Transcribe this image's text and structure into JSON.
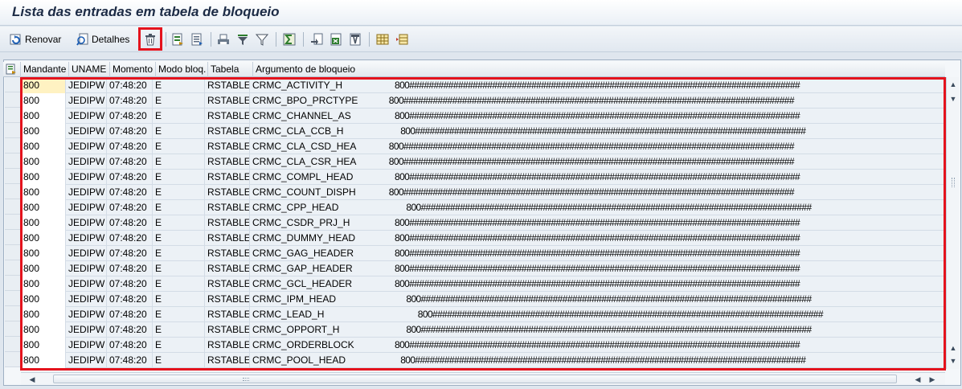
{
  "window": {
    "title": "Lista das entradas em tabela de bloqueio"
  },
  "toolbar": {
    "refresh_label": "Renovar",
    "details_label": "Detalhes",
    "icons": [
      "refresh-icon",
      "details-icon",
      "delete-icon",
      "select-layout-icon",
      "choose-layout-icon",
      "print-icon",
      "filter-set-icon",
      "filter-icon",
      "sum-icon",
      "export-icon",
      "excel-icon",
      "word-icon",
      "grid-icon",
      "layout-icon"
    ]
  },
  "colors": {
    "highlight": "#e4131d",
    "row_bg": "#ecf1f6",
    "selected_cell": "#fff2c2"
  },
  "table": {
    "columns": [
      "Mandante",
      "UNAME",
      "Momento",
      "Modo bloq.",
      "Tabela",
      "Argumento de bloqueio"
    ],
    "rows": [
      {
        "mandante": "800",
        "uname": "JEDIPW",
        "momento": "07:48:20",
        "modo": "E",
        "tabela": "RSTABLE",
        "obj": "CRMC_ACTIVITY_H",
        "arg": "800################################################################################"
      },
      {
        "mandante": "800",
        "uname": "JEDIPW",
        "momento": "07:48:20",
        "modo": "E",
        "tabela": "RSTABLE",
        "obj": "CRMC_BPO_PRCTYPE",
        "arg": "800################################################################################"
      },
      {
        "mandante": "800",
        "uname": "JEDIPW",
        "momento": "07:48:20",
        "modo": "E",
        "tabela": "RSTABLE",
        "obj": "CRMC_CHANNEL_AS",
        "arg": "800################################################################################"
      },
      {
        "mandante": "800",
        "uname": "JEDIPW",
        "momento": "07:48:20",
        "modo": "E",
        "tabela": "RSTABLE",
        "obj": "CRMC_CLA_CCB_H",
        "arg": "800################################################################################"
      },
      {
        "mandante": "800",
        "uname": "JEDIPW",
        "momento": "07:48:20",
        "modo": "E",
        "tabela": "RSTABLE",
        "obj": "CRMC_CLA_CSD_HEA",
        "arg": "800################################################################################"
      },
      {
        "mandante": "800",
        "uname": "JEDIPW",
        "momento": "07:48:20",
        "modo": "E",
        "tabela": "RSTABLE",
        "obj": "CRMC_CLA_CSR_HEA",
        "arg": "800################################################################################"
      },
      {
        "mandante": "800",
        "uname": "JEDIPW",
        "momento": "07:48:20",
        "modo": "E",
        "tabela": "RSTABLE",
        "obj": "CRMC_COMPL_HEAD",
        "arg": "800################################################################################"
      },
      {
        "mandante": "800",
        "uname": "JEDIPW",
        "momento": "07:48:20",
        "modo": "E",
        "tabela": "RSTABLE",
        "obj": "CRMC_COUNT_DISPH",
        "arg": "800################################################################################"
      },
      {
        "mandante": "800",
        "uname": "JEDIPW",
        "momento": "07:48:20",
        "modo": "E",
        "tabela": "RSTABLE",
        "obj": "CRMC_CPP_HEAD",
        "arg": "800################################################################################"
      },
      {
        "mandante": "800",
        "uname": "JEDIPW",
        "momento": "07:48:20",
        "modo": "E",
        "tabela": "RSTABLE",
        "obj": "CRMC_CSDR_PRJ_H",
        "arg": "800################################################################################"
      },
      {
        "mandante": "800",
        "uname": "JEDIPW",
        "momento": "07:48:20",
        "modo": "E",
        "tabela": "RSTABLE",
        "obj": "CRMC_DUMMY_HEAD",
        "arg": "800################################################################################"
      },
      {
        "mandante": "800",
        "uname": "JEDIPW",
        "momento": "07:48:20",
        "modo": "E",
        "tabela": "RSTABLE",
        "obj": "CRMC_GAG_HEADER",
        "arg": "800################################################################################"
      },
      {
        "mandante": "800",
        "uname": "JEDIPW",
        "momento": "07:48:20",
        "modo": "E",
        "tabela": "RSTABLE",
        "obj": "CRMC_GAP_HEADER",
        "arg": "800################################################################################"
      },
      {
        "mandante": "800",
        "uname": "JEDIPW",
        "momento": "07:48:20",
        "modo": "E",
        "tabela": "RSTABLE",
        "obj": "CRMC_GCL_HEADER",
        "arg": "800################################################################################"
      },
      {
        "mandante": "800",
        "uname": "JEDIPW",
        "momento": "07:48:20",
        "modo": "E",
        "tabela": "RSTABLE",
        "obj": "CRMC_IPM_HEAD",
        "arg": "800################################################################################"
      },
      {
        "mandante": "800",
        "uname": "JEDIPW",
        "momento": "07:48:20",
        "modo": "E",
        "tabela": "RSTABLE",
        "obj": "CRMC_LEAD_H",
        "arg": "800################################################################################"
      },
      {
        "mandante": "800",
        "uname": "JEDIPW",
        "momento": "07:48:20",
        "modo": "E",
        "tabela": "RSTABLE",
        "obj": "CRMC_OPPORT_H",
        "arg": "800################################################################################"
      },
      {
        "mandante": "800",
        "uname": "JEDIPW",
        "momento": "07:48:20",
        "modo": "E",
        "tabela": "RSTABLE",
        "obj": "CRMC_ORDERBLOCK",
        "arg": "800################################################################################"
      },
      {
        "mandante": "800",
        "uname": "JEDIPW",
        "momento": "07:48:20",
        "modo": "E",
        "tabela": "RSTABLE",
        "obj": "CRMC_POOL_HEAD",
        "arg": "800################################################################################"
      }
    ]
  }
}
